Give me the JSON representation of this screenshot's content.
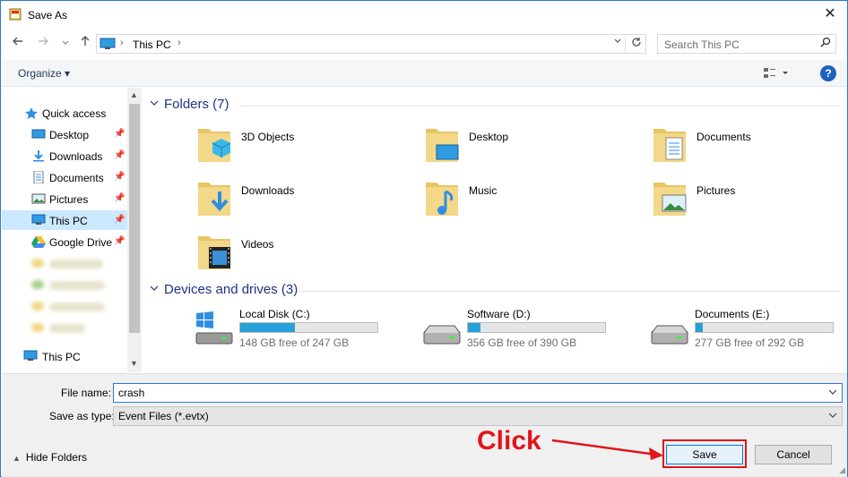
{
  "window": {
    "title": "Save As",
    "close_glyph": "✕"
  },
  "nav": {
    "back_icon": "arrow-left-icon",
    "forward_icon": "arrow-right-icon",
    "recent_icon": "chevron-down-icon",
    "up_icon": "arrow-up-icon",
    "address": {
      "breadcrumb": "This PC",
      "sep": "›"
    },
    "search_placeholder": "Search This PC"
  },
  "toolbar": {
    "organize_label": "Organize ▾"
  },
  "sidebar": {
    "quick_access": "Quick access",
    "items": [
      {
        "label": "Desktop",
        "pinned": true
      },
      {
        "label": "Downloads",
        "pinned": true
      },
      {
        "label": "Documents",
        "pinned": true
      },
      {
        "label": "Pictures",
        "pinned": true
      },
      {
        "label": "This PC",
        "pinned": true,
        "selected": true
      },
      {
        "label": "Google Drive",
        "pinned": true
      }
    ],
    "bottom_item": "This PC"
  },
  "main": {
    "folders_header": "Folders (7)",
    "folders": [
      {
        "label": "3D Objects",
        "icon": "3d-objects-icon"
      },
      {
        "label": "Desktop",
        "icon": "desktop-folder-icon"
      },
      {
        "label": "Documents",
        "icon": "documents-folder-icon"
      },
      {
        "label": "Downloads",
        "icon": "downloads-folder-icon"
      },
      {
        "label": "Music",
        "icon": "music-folder-icon"
      },
      {
        "label": "Pictures",
        "icon": "pictures-folder-icon"
      },
      {
        "label": "Videos",
        "icon": "videos-folder-icon"
      }
    ],
    "drives_header": "Devices and drives (3)",
    "drives": [
      {
        "label": "Local Disk (C:)",
        "free": "148 GB free of 247 GB",
        "used_fraction": 0.4
      },
      {
        "label": "Software (D:)",
        "free": "356 GB free of 390 GB",
        "used_fraction": 0.09
      },
      {
        "label": "Documents (E:)",
        "free": "277 GB free of 292 GB",
        "used_fraction": 0.05
      }
    ]
  },
  "form": {
    "file_name_label": "File name:",
    "file_name_value": "crash",
    "save_type_label": "Save as type:",
    "save_type_value": "Event Files (*.evtx)",
    "hide_folders": "Hide Folders",
    "save": "Save",
    "cancel": "Cancel"
  },
  "annotation": {
    "text": "Click",
    "color": "#e0151c"
  },
  "colors": {
    "accent": "#2b7bd3",
    "header_blue": "#1e3287",
    "drive_fill": "#26a0da"
  }
}
